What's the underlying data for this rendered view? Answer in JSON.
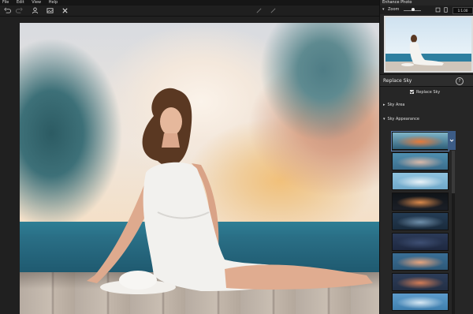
{
  "menu": [
    "File",
    "Edit",
    "View",
    "Help"
  ],
  "toolbar_icons": [
    "undo-icon",
    "redo-icon",
    "person-icon",
    "image-icon",
    "close-icon"
  ],
  "panel": {
    "title": "Enhance Photo",
    "zoom_label": "Zoom",
    "zoom_value": "1:1.00",
    "zoom_level": 0.55
  },
  "replace_sky": {
    "section_title": "Replace Sky",
    "help": "?",
    "checkbox_label": "Replace Sky",
    "checked": true,
    "sky_area_label": "Sky Area",
    "sky_appearance_label": "Sky Appearance"
  },
  "sky_thumbnails": [
    {
      "top": "#7fb4c8",
      "mid": "#e57a3a",
      "bot": "#2f5f78"
    },
    {
      "top": "#4f8fb0",
      "mid": "#d9b8a8",
      "bot": "#3b6d8c"
    },
    {
      "top": "#8fc3df",
      "mid": "#e9f2f7",
      "bot": "#6fa8c9"
    },
    {
      "top": "#101418",
      "mid": "#d9884a",
      "bot": "#1b1f27"
    },
    {
      "top": "#243c55",
      "mid": "#6e8ea9",
      "bot": "#1a2b3c"
    },
    {
      "top": "#2b3a58",
      "mid": "#3e4f73",
      "bot": "#1e2840"
    },
    {
      "top": "#3a6f96",
      "mid": "#e7a47d",
      "bot": "#2d5878"
    },
    {
      "top": "#2c3d59",
      "mid": "#d27c56",
      "bot": "#232f45"
    },
    {
      "top": "#5d9ccc",
      "mid": "#d7e8f3",
      "bot": "#3f7fae"
    }
  ],
  "accent": "#3c5c86"
}
